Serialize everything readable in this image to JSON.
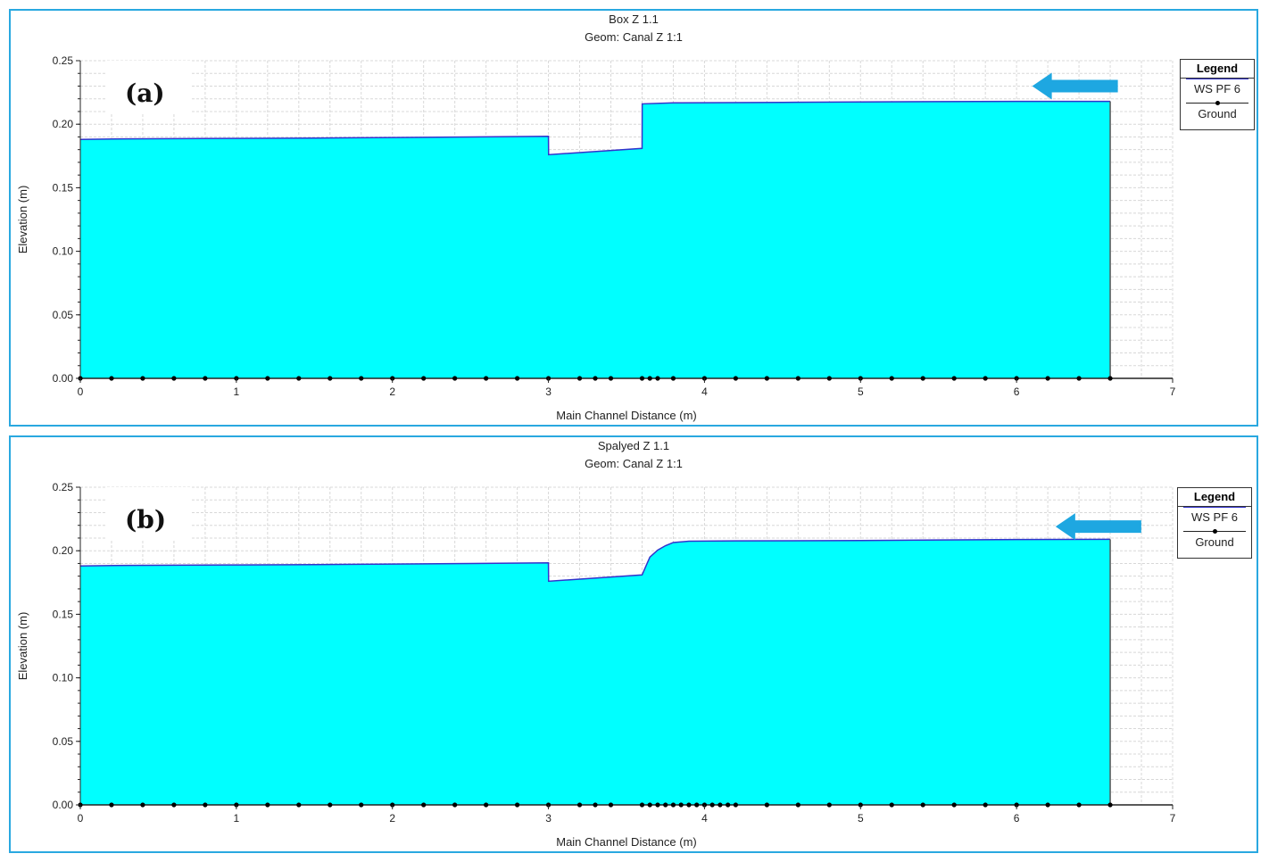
{
  "chart_data": [
    {
      "type": "area",
      "panel_label": "(a)",
      "title": "Box Z 1.1",
      "subtitle": "Geom: Canal Z 1:1",
      "xlabel": "Main Channel Distance (m)",
      "ylabel": "Elevation (m)",
      "xlim": [
        0,
        7
      ],
      "ylim": [
        0,
        0.25
      ],
      "xticks": [
        "0",
        "1",
        "2",
        "3",
        "4",
        "5",
        "6",
        "7"
      ],
      "yticks": [
        "0.00",
        "0.05",
        "0.10",
        "0.15",
        "0.20",
        "0.25"
      ],
      "legend": {
        "title": "Legend",
        "entries": [
          "WS  PF 6",
          "Ground"
        ],
        "position": "right"
      },
      "series": [
        {
          "name": "WS  PF 6",
          "fill": "#00ffff",
          "line": "#3333cc",
          "x": [
            0,
            0.3,
            1,
            1.5,
            2,
            2.5,
            3,
            3.001,
            3.6,
            3.601,
            3.8,
            4.5,
            5,
            5.5,
            6,
            6.6
          ],
          "y": [
            0.188,
            0.1885,
            0.1888,
            0.1891,
            0.1895,
            0.19,
            0.1905,
            0.176,
            0.181,
            0.216,
            0.2168,
            0.2172,
            0.2175,
            0.2178,
            0.218,
            0.218
          ]
        },
        {
          "name": "Ground",
          "color": "#000000",
          "x": [
            0,
            0.2,
            0.4,
            0.6,
            0.8,
            1.0,
            1.2,
            1.4,
            1.6,
            1.8,
            2.0,
            2.2,
            2.4,
            2.6,
            2.8,
            3.0,
            3.2,
            3.3,
            3.4,
            3.6,
            3.65,
            3.7,
            3.8,
            4.0,
            4.2,
            4.4,
            4.6,
            4.8,
            5.0,
            5.2,
            5.4,
            5.6,
            5.8,
            6.0,
            6.2,
            6.4,
            6.6
          ],
          "y": [
            0,
            0,
            0,
            0,
            0,
            0,
            0,
            0,
            0,
            0,
            0,
            0,
            0,
            0,
            0,
            0,
            0,
            0,
            0,
            0,
            0,
            0,
            0,
            0,
            0,
            0,
            0,
            0,
            0,
            0,
            0,
            0,
            0,
            0,
            0,
            0,
            0
          ]
        }
      ],
      "annotations": [
        {
          "type": "arrow",
          "direction": "left",
          "color": "#1ea7e1",
          "x": 6.1,
          "y": 0.23
        }
      ]
    },
    {
      "type": "area",
      "panel_label": "(b)",
      "title": "Spalyed Z 1.1",
      "subtitle": "Geom: Canal Z 1:1",
      "xlabel": "Main Channel Distance (m)",
      "ylabel": "Elevation (m)",
      "xlim": [
        0,
        7
      ],
      "ylim": [
        0,
        0.25
      ],
      "xticks": [
        "0",
        "1",
        "2",
        "3",
        "4",
        "5",
        "6",
        "7"
      ],
      "yticks": [
        "0.00",
        "0.05",
        "0.10",
        "0.15",
        "0.20",
        "0.25"
      ],
      "legend": {
        "title": "Legend",
        "entries": [
          "WS  PF 6",
          "Ground"
        ],
        "position": "right"
      },
      "series": [
        {
          "name": "WS  PF 6",
          "fill": "#00ffff",
          "line": "#3333cc",
          "x": [
            0,
            0.3,
            1,
            1.5,
            2,
            2.5,
            3,
            3.001,
            3.6,
            3.65,
            3.7,
            3.75,
            3.8,
            3.9,
            4.2,
            5,
            5.5,
            6,
            6.6
          ],
          "y": [
            0.188,
            0.1885,
            0.1888,
            0.1891,
            0.1895,
            0.19,
            0.1905,
            0.176,
            0.181,
            0.195,
            0.2005,
            0.204,
            0.2065,
            0.2075,
            0.2078,
            0.208,
            0.2085,
            0.2088,
            0.209
          ]
        },
        {
          "name": "Ground",
          "color": "#000000",
          "x": [
            0,
            0.2,
            0.4,
            0.6,
            0.8,
            1.0,
            1.2,
            1.4,
            1.6,
            1.8,
            2.0,
            2.2,
            2.4,
            2.6,
            2.8,
            3.0,
            3.2,
            3.3,
            3.4,
            3.6,
            3.65,
            3.7,
            3.75,
            3.8,
            3.85,
            3.9,
            3.95,
            4.0,
            4.05,
            4.1,
            4.15,
            4.2,
            4.4,
            4.6,
            4.8,
            5.0,
            5.2,
            5.4,
            5.6,
            5.8,
            6.0,
            6.2,
            6.4,
            6.6
          ],
          "y": [
            0,
            0,
            0,
            0,
            0,
            0,
            0,
            0,
            0,
            0,
            0,
            0,
            0,
            0,
            0,
            0,
            0,
            0,
            0,
            0,
            0,
            0,
            0,
            0,
            0,
            0,
            0,
            0,
            0,
            0,
            0,
            0,
            0,
            0,
            0,
            0,
            0,
            0,
            0,
            0,
            0,
            0,
            0,
            0
          ]
        }
      ],
      "annotations": [
        {
          "type": "arrow",
          "direction": "left",
          "color": "#1ea7e1",
          "x": 6.25,
          "y": 0.219
        }
      ]
    }
  ]
}
